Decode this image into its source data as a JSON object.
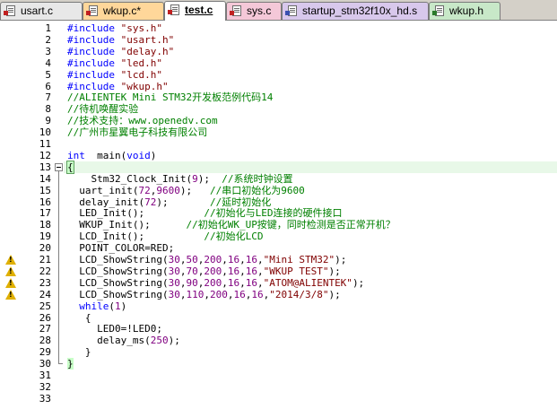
{
  "tabs": [
    {
      "label": "usart.c",
      "type": "c",
      "active": false,
      "color": "#e8e8e8"
    },
    {
      "label": "wkup.c*",
      "type": "c",
      "active": false,
      "color": "#ffd79a"
    },
    {
      "label": "test.c",
      "type": "c",
      "active": true,
      "color": "#ffffff"
    },
    {
      "label": "sys.c",
      "type": "c",
      "active": false,
      "color": "#f4c8d8"
    },
    {
      "label": "startup_stm32f10x_hd.s",
      "type": "s",
      "active": false,
      "color": "#d8c8ec"
    },
    {
      "label": "wkup.h",
      "type": "h",
      "active": false,
      "color": "#c8e8c8"
    }
  ],
  "editor": {
    "current_line": 13,
    "warning_lines": [
      21,
      22,
      23,
      24
    ],
    "lines": [
      {
        "n": "1",
        "t": [
          [
            "pp",
            "#include "
          ],
          [
            "str",
            "\"sys.h\""
          ]
        ]
      },
      {
        "n": "2",
        "t": [
          [
            "pp",
            "#include "
          ],
          [
            "str",
            "\"usart.h\""
          ]
        ]
      },
      {
        "n": "3",
        "t": [
          [
            "pp",
            "#include "
          ],
          [
            "str",
            "\"delay.h\""
          ]
        ]
      },
      {
        "n": "4",
        "t": [
          [
            "pp",
            "#include "
          ],
          [
            "str",
            "\"led.h\""
          ]
        ]
      },
      {
        "n": "5",
        "t": [
          [
            "pp",
            "#include "
          ],
          [
            "str",
            "\"lcd.h\""
          ]
        ]
      },
      {
        "n": "6",
        "t": [
          [
            "pp",
            "#include "
          ],
          [
            "str",
            "\"wkup.h\""
          ]
        ]
      },
      {
        "n": "7",
        "t": [
          [
            "cm",
            "//ALIENTEK Mini STM32开发板范例代码14"
          ]
        ]
      },
      {
        "n": "8",
        "t": [
          [
            "cm",
            "//待机唤醒实验"
          ]
        ]
      },
      {
        "n": "9",
        "t": [
          [
            "cm",
            "//技术支持：www.openedv.com"
          ]
        ]
      },
      {
        "n": "10",
        "t": [
          [
            "cm",
            "//广州市星翼电子科技有限公司"
          ]
        ]
      },
      {
        "n": "11",
        "t": []
      },
      {
        "n": "12",
        "t": [
          [
            "kw",
            "int"
          ],
          [
            "",
            "  main("
          ],
          [
            "kw",
            "void"
          ],
          [
            "",
            ")"
          ]
        ]
      },
      {
        "n": "13",
        "t": [
          [
            "brace",
            "{"
          ]
        ]
      },
      {
        "n": "14",
        "t": [
          [
            "",
            "    Stm32_Clock_Init("
          ],
          [
            "num",
            "9"
          ],
          [
            "",
            ");  "
          ],
          [
            "cm",
            "//系统时钟设置"
          ]
        ]
      },
      {
        "n": "15",
        "t": [
          [
            "",
            "  uart_init("
          ],
          [
            "num",
            "72"
          ],
          [
            "",
            ","
          ],
          [
            "num",
            "9600"
          ],
          [
            "",
            ");   "
          ],
          [
            "cm",
            "//串口初始化为9600"
          ]
        ]
      },
      {
        "n": "16",
        "t": [
          [
            "",
            "  delay_init("
          ],
          [
            "num",
            "72"
          ],
          [
            "",
            ");       "
          ],
          [
            "cm",
            "//延时初始化"
          ]
        ]
      },
      {
        "n": "17",
        "t": [
          [
            "",
            "  LED_Init();          "
          ],
          [
            "cm",
            "//初始化与LED连接的硬件接口"
          ]
        ]
      },
      {
        "n": "18",
        "t": [
          [
            "",
            "  WKUP_Init();      "
          ],
          [
            "cm",
            "//初始化WK_UP按键，同时检测是否正常开机？"
          ]
        ]
      },
      {
        "n": "19",
        "t": [
          [
            "",
            "  LCD_Init();          "
          ],
          [
            "cm",
            "//初始化LCD"
          ]
        ]
      },
      {
        "n": "20",
        "t": [
          [
            "",
            "  POINT_COLOR=RED;"
          ]
        ]
      },
      {
        "n": "21",
        "t": [
          [
            "",
            "  LCD_ShowString("
          ],
          [
            "num",
            "30"
          ],
          [
            "",
            ","
          ],
          [
            "num",
            "50"
          ],
          [
            "",
            ","
          ],
          [
            "num",
            "200"
          ],
          [
            "",
            ","
          ],
          [
            "num",
            "16"
          ],
          [
            "",
            ","
          ],
          [
            "num",
            "16"
          ],
          [
            "",
            ","
          ],
          [
            "str",
            "\"Mini STM32\""
          ],
          [
            "",
            ");"
          ]
        ]
      },
      {
        "n": "22",
        "t": [
          [
            "",
            "  LCD_ShowString("
          ],
          [
            "num",
            "30"
          ],
          [
            "",
            ","
          ],
          [
            "num",
            "70"
          ],
          [
            "",
            ","
          ],
          [
            "num",
            "200"
          ],
          [
            "",
            ","
          ],
          [
            "num",
            "16"
          ],
          [
            "",
            ","
          ],
          [
            "num",
            "16"
          ],
          [
            "",
            ","
          ],
          [
            "str",
            "\"WKUP TEST\""
          ],
          [
            "",
            ");"
          ]
        ]
      },
      {
        "n": "23",
        "t": [
          [
            "",
            "  LCD_ShowString("
          ],
          [
            "num",
            "30"
          ],
          [
            "",
            ","
          ],
          [
            "num",
            "90"
          ],
          [
            "",
            ","
          ],
          [
            "num",
            "200"
          ],
          [
            "",
            ","
          ],
          [
            "num",
            "16"
          ],
          [
            "",
            ","
          ],
          [
            "num",
            "16"
          ],
          [
            "",
            ","
          ],
          [
            "str",
            "\"ATOM@ALIENTEK\""
          ],
          [
            "",
            ");"
          ]
        ]
      },
      {
        "n": "24",
        "t": [
          [
            "",
            "  LCD_ShowString("
          ],
          [
            "num",
            "30"
          ],
          [
            "",
            ","
          ],
          [
            "num",
            "110"
          ],
          [
            "",
            ","
          ],
          [
            "num",
            "200"
          ],
          [
            "",
            ","
          ],
          [
            "num",
            "16"
          ],
          [
            "",
            ","
          ],
          [
            "num",
            "16"
          ],
          [
            "",
            ","
          ],
          [
            "str",
            "\"2014/3/8\""
          ],
          [
            "",
            ");"
          ]
        ]
      },
      {
        "n": "25",
        "t": [
          [
            "kw",
            "  while"
          ],
          [
            "",
            "("
          ],
          [
            "num",
            "1"
          ],
          [
            "",
            ")"
          ]
        ]
      },
      {
        "n": "26",
        "t": [
          [
            "",
            "   {"
          ]
        ]
      },
      {
        "n": "27",
        "t": [
          [
            "",
            "     LED0=!LED0;"
          ]
        ]
      },
      {
        "n": "28",
        "t": [
          [
            "",
            "     delay_ms("
          ],
          [
            "num",
            "250"
          ],
          [
            "",
            ");"
          ]
        ]
      },
      {
        "n": "29",
        "t": [
          [
            "",
            "   }"
          ]
        ]
      },
      {
        "n": "30",
        "t": [
          [
            "close",
            "}"
          ]
        ]
      },
      {
        "n": "31",
        "t": []
      },
      {
        "n": "32",
        "t": []
      },
      {
        "n": "33",
        "t": []
      }
    ]
  }
}
